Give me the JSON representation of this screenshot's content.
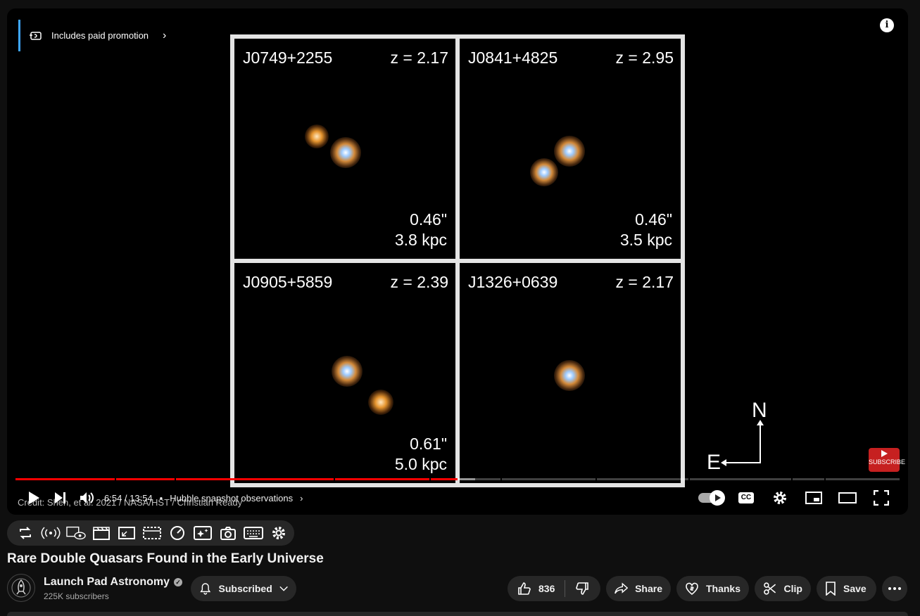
{
  "player": {
    "promo_label": "Includes paid promotion",
    "info_glyph": "i",
    "panels": [
      {
        "name": "J0749+2255",
        "z": "z = 2.17",
        "sep_arcsec": "0.46\"",
        "sep_kpc": "3.8 kpc"
      },
      {
        "name": "J0841+4825",
        "z": "z = 2.95",
        "sep_arcsec": "0.46\"",
        "sep_kpc": "3.5 kpc"
      },
      {
        "name": "J0905+5859",
        "z": "z = 2.39",
        "sep_arcsec": "0.61\"",
        "sep_kpc": "5.0 kpc"
      },
      {
        "name": "J1326+0639",
        "z": "z = 2.17",
        "sep_arcsec": "",
        "sep_kpc": ""
      }
    ],
    "compass": {
      "north": "N",
      "east": "E"
    },
    "subscribe_watermark": "SUBSCRIBE",
    "credit": "Credit: Shen, et al. 2021 / NASA/HST / Christian Ready",
    "time": "6:54 / 13:54",
    "chapter": "Hubble snapshot observations",
    "progress_fraction": 0.5,
    "buffered_fraction": 0.52,
    "cc_label": "CC",
    "accent_color": "#ff0000"
  },
  "extension_toolbar": {
    "icons": [
      "repeat-icon",
      "broadcast-icon",
      "eye-overlay-icon",
      "clapper-icon",
      "picture-in-picture-icon",
      "dotted-frame-icon",
      "speed-icon",
      "sparkle-icon",
      "camera-icon",
      "keyboard-icon",
      "gear-icon"
    ]
  },
  "video": {
    "title": "Rare Double Quasars Found in the Early Universe",
    "channel_name": "Launch Pad Astronomy",
    "subscribers": "225K subscribers",
    "subscribed_label": "Subscribed",
    "likes": "836",
    "share_label": "Share",
    "thanks_label": "Thanks",
    "clip_label": "Clip",
    "save_label": "Save"
  }
}
